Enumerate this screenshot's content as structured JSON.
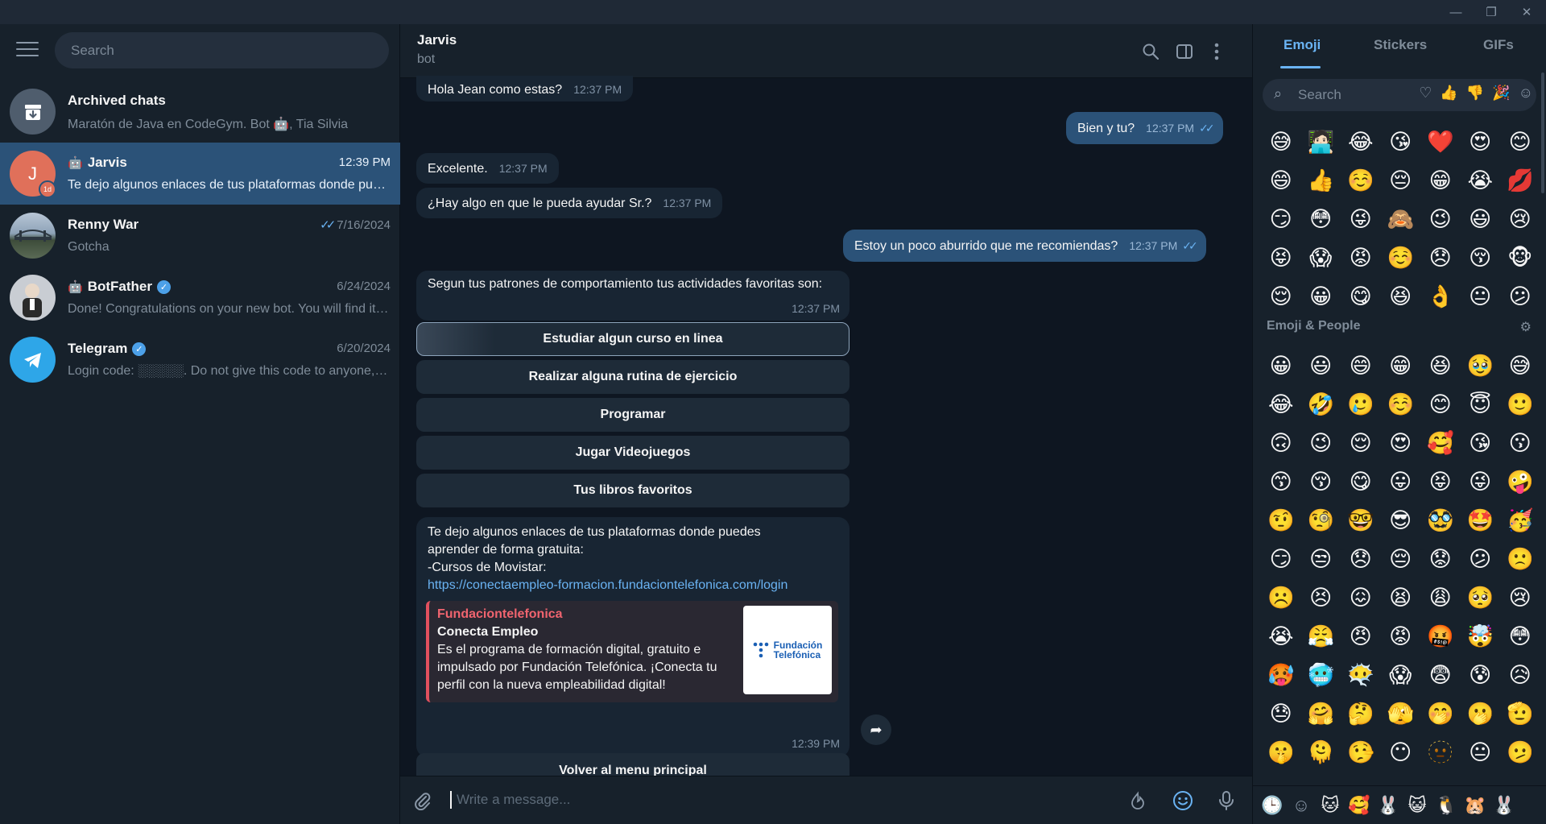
{
  "window": {
    "minimize": "—",
    "restore": "❐",
    "close": "✕"
  },
  "sidebar": {
    "search_placeholder": "Search",
    "chats": [
      {
        "name": "Archived chats",
        "preview": "Maratón de Java en CodeGym. Bot 🤖, Tia Silvia",
        "date": ""
      },
      {
        "name": "Jarvis",
        "preview": "Te dejo algunos enlaces de tus plataformas donde puedes aprender de forma gratuita",
        "date": "12:39 PM",
        "avatar_letter": "J",
        "badge": "1d"
      },
      {
        "name": "Renny War",
        "preview": "Gotcha",
        "date": "7/16/2024"
      },
      {
        "name": "BotFather",
        "preview": "Done! Congratulations on your new bot. You will find it at",
        "date": "6/24/2024"
      },
      {
        "name": "Telegram",
        "preview": "Login code: ░░░░░. Do not give this code to anyone, even if they say they are from Telegram!",
        "date": "6/20/2024"
      }
    ]
  },
  "header": {
    "title": "Jarvis",
    "subtitle": "bot"
  },
  "messages": {
    "m1": {
      "text": "Hola Jean como estas?",
      "time": "12:37 PM"
    },
    "m2": {
      "text": "Bien y tu?",
      "time": "12:37 PM"
    },
    "m3": {
      "text": "Excelente.",
      "time": "12:37 PM"
    },
    "m4": {
      "text": "¿Hay algo en que le pueda ayudar Sr.?",
      "time": "12:37 PM"
    },
    "m5": {
      "text": "Estoy un poco aburrido que me recomiendas?",
      "time": "12:37 PM"
    },
    "m6": {
      "text": "Segun tus patrones de comportamiento tus actividades favoritas son:",
      "time": "12:37 PM"
    },
    "keyboard": [
      "Estudiar algun curso en linea",
      "Realizar alguna rutina de ejercicio",
      "Programar",
      "Jugar Videojuegos",
      "Tus libros favoritos"
    ],
    "m7": {
      "line1": "Te dejo algunos enlaces de tus plataformas donde puedes",
      "line2": "aprender de forma gratuita:",
      "line3": "-Cursos de Movistar:",
      "link": "https://conectaempleo-formacion.fundaciontelefonica.com/login",
      "preview_site": "Fundaciontelefonica",
      "preview_title": "Conecta Empleo",
      "preview_desc": "Es el programa de formación digital, gratuito e impulsado por Fundación Telefónica. ¡Conecta tu perfil con la nueva empleabilidad digital!",
      "thumb_line1": "Fundación",
      "thumb_line2": "Telefónica",
      "time": "12:39 PM"
    },
    "menu_button": "Volver al menu principal"
  },
  "composer": {
    "placeholder": "Write a message..."
  },
  "emoji_panel": {
    "tabs": [
      "Emoji",
      "Stickers",
      "GIFs"
    ],
    "search_placeholder": "Search",
    "section_title": "Emoji & People",
    "recent": [
      "😅",
      "🧑🏻‍💻",
      "😂",
      "😘",
      "❤️",
      "😍",
      "😊",
      "😄",
      "👍",
      "☺️",
      "😔",
      "😁",
      "😭",
      "💋",
      "😏",
      "😳",
      "😜",
      "🙈",
      "😉",
      "😃",
      "😢",
      "😝",
      "😱",
      "😡",
      "☺️",
      "😞",
      "😚",
      "🐵",
      "😌",
      "😀",
      "😋",
      "😆",
      "👌",
      "😐",
      "😕"
    ],
    "people": [
      "😀",
      "😃",
      "😄",
      "😁",
      "😆",
      "🥹",
      "😅",
      "😂",
      "🤣",
      "🥲",
      "☺️",
      "😊",
      "😇",
      "🙂",
      "🙃",
      "😉",
      "😌",
      "😍",
      "🥰",
      "😘",
      "😗",
      "😙",
      "😚",
      "😋",
      "😛",
      "😝",
      "😜",
      "🤪",
      "🤨",
      "🧐",
      "🤓",
      "😎",
      "🥸",
      "🤩",
      "🥳",
      "😏",
      "😒",
      "😞",
      "😔",
      "😟",
      "😕",
      "🙁",
      "☹️",
      "😣",
      "😖",
      "😫",
      "😩",
      "🥺",
      "😢",
      "😭",
      "😤",
      "😠",
      "😡",
      "🤬",
      "🤯",
      "😳",
      "🥵",
      "🥶",
      "😶‍🌫️",
      "😱",
      "😨",
      "😰",
      "😥",
      "😓",
      "🤗",
      "🤔",
      "🫣",
      "🤭",
      "🫢",
      "🫡",
      "🤫",
      "🫠",
      "🤥",
      "😶",
      "🫥",
      "😐",
      "🫤"
    ],
    "footer": [
      "🕒",
      "☺",
      "🐱",
      "🥰",
      "🐰",
      "😺",
      "🐧",
      "🐹",
      "🐰"
    ]
  }
}
